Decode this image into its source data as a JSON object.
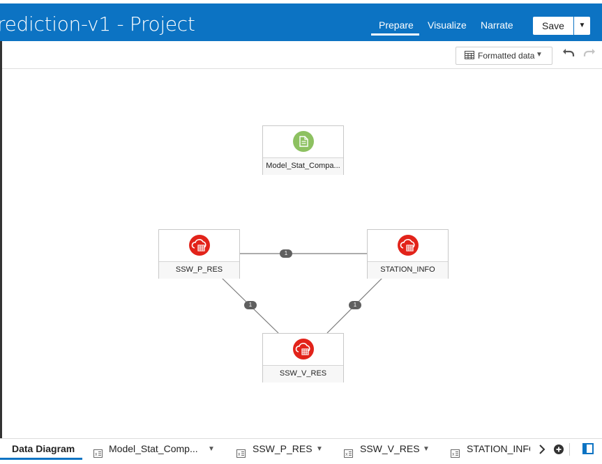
{
  "header": {
    "title": "rediction-v1 - Project",
    "tabs": [
      "Prepare",
      "Visualize",
      "Narrate"
    ],
    "save_label": "Save",
    "save_menu_icon": "caret-down-icon"
  },
  "toolbar": {
    "format_label": "Formatted data",
    "format_icon": "table-icon",
    "undo_icon": "undo-icon",
    "redo_icon": "redo-icon"
  },
  "diagram": {
    "nodes": [
      {
        "id": "model",
        "label": "Model_Stat_Compa...",
        "icon": "document-icon",
        "icon_color": "#8dc161"
      },
      {
        "id": "ssw_p",
        "label": "SSW_P_RES",
        "icon": "cloud-table-icon",
        "icon_color": "#e2231a"
      },
      {
        "id": "station",
        "label": "STATION_INFO",
        "icon": "cloud-table-icon",
        "icon_color": "#e2231a"
      },
      {
        "id": "ssw_v",
        "label": "SSW_V_RES",
        "icon": "cloud-table-icon",
        "icon_color": "#e2231a"
      }
    ],
    "links": [
      {
        "from": "ssw_p",
        "to": "station",
        "count": "1"
      },
      {
        "from": "ssw_p",
        "to": "ssw_v",
        "count": "1"
      },
      {
        "from": "station",
        "to": "ssw_v",
        "count": "1"
      }
    ]
  },
  "bottom_tabs": {
    "items": [
      {
        "label": "Data Diagram"
      },
      {
        "label": "Model_Stat_Comp...",
        "icon": "excel-icon"
      },
      {
        "label": "SSW_P_RES",
        "icon": "excel-icon"
      },
      {
        "label": "SSW_V_RES",
        "icon": "excel-icon"
      },
      {
        "label": "STATION_INFC",
        "icon": "excel-icon"
      }
    ],
    "more_icon": "chevron-right-icon",
    "add_icon": "plus-circle-icon",
    "panel_icon": "panel-toggle-icon"
  },
  "colors": {
    "header_bg": "#0c73c3",
    "accent": "#0c73c3",
    "source_icon": "#e2231a",
    "file_icon": "#8dc161"
  }
}
